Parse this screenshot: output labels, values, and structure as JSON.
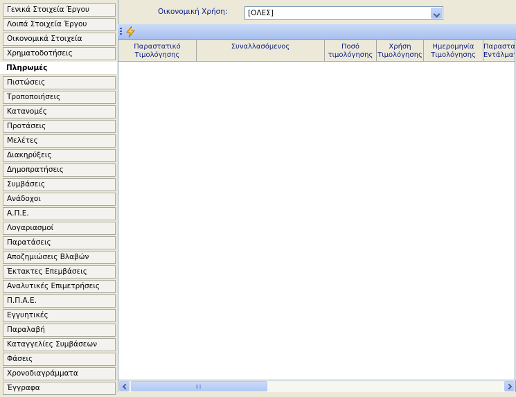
{
  "sidebar": {
    "items": [
      {
        "label": "Γενικά Στοιχεία Έργου",
        "active": false
      },
      {
        "label": "Λοιπά Στοιχεία Έργου",
        "active": false
      },
      {
        "label": "Οικονομικά Στοιχεία",
        "active": false
      },
      {
        "label": "Χρηματοδοτήσεις",
        "active": false
      },
      {
        "label": "Πληρωμές",
        "active": true
      },
      {
        "label": "Πιστώσεις",
        "active": false
      },
      {
        "label": "Τροποποιήσεις",
        "active": false
      },
      {
        "label": "Κατανομές",
        "active": false
      },
      {
        "label": "Προτάσεις",
        "active": false
      },
      {
        "label": "Μελέτες",
        "active": false
      },
      {
        "label": "Διακηρύξεις",
        "active": false
      },
      {
        "label": "Δημοπρατήσεις",
        "active": false
      },
      {
        "label": "Συμβάσεις",
        "active": false
      },
      {
        "label": "Ανάδοχοι",
        "active": false
      },
      {
        "label": "Α.Π.Ε.",
        "active": false
      },
      {
        "label": "Λογαριασμοί",
        "active": false
      },
      {
        "label": "Παρατάσεις",
        "active": false
      },
      {
        "label": "Αποζημιώσεις Βλαβών",
        "active": false
      },
      {
        "label": "Έκτακτες Επεμβάσεις",
        "active": false
      },
      {
        "label": "Αναλυτικές Επιμετρήσεις",
        "active": false
      },
      {
        "label": "Π.Π.Α.Ε.",
        "active": false
      },
      {
        "label": "Εγγυητικές",
        "active": false
      },
      {
        "label": "Παραλαβή",
        "active": false
      },
      {
        "label": "Καταγγελίες Συμβάσεων",
        "active": false
      },
      {
        "label": "Φάσεις",
        "active": false
      },
      {
        "label": "Χρονοδιαγράμματα",
        "active": false
      },
      {
        "label": "Έγγραφα",
        "active": false
      }
    ]
  },
  "filter": {
    "label": "Οικονομική Χρήση:",
    "selected": "[ΟΛΕΣ]"
  },
  "toolbar": {
    "refresh_icon": "lightning-icon"
  },
  "grid": {
    "columns": [
      "Παραστατικό Τιμολόγησης",
      "Συναλλασόμενος",
      "Ποσό τιμολόγησης",
      "Χρήση Τιμολόγησης",
      "Ημερομηνία Τιμολόγησης",
      "Παραστατικό Εντάλματος"
    ],
    "rows": []
  },
  "colors": {
    "toolbar": "#a6bff0",
    "header_text": "#0b1e84",
    "panel_bg": "#ece9d8"
  }
}
